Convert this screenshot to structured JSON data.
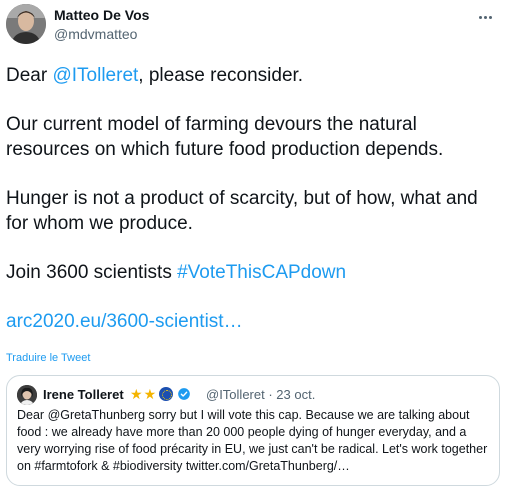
{
  "author": {
    "name": "Matteo De Vos",
    "handle": "@mdvmatteo"
  },
  "tweet": {
    "line1_prefix": "Dear ",
    "line1_mention": "@ITolleret",
    "line1_suffix": ", please reconsider.",
    "para2": "Our current model of farming devours the natural resources on which future food production depends.",
    "para3": "Hunger is not a product of scarcity, but of how, what and for whom we produce.",
    "para4_prefix": "Join 3600 scientists ",
    "para4_hashtag": "#VoteThisCAPdown",
    "link": "arc2020.eu/3600-scientist…"
  },
  "translate_label": "Traduire le Tweet",
  "quoted": {
    "name": "Irene Tolleret",
    "badges": [
      "star-icon",
      "star-icon",
      "eu-flag-icon",
      "verified-icon"
    ],
    "handle": "@ITolleret",
    "separator": " · ",
    "date": "23 oct.",
    "text": "Dear @GretaThunberg sorry but I will vote this cap. Because we are talking about food : we already have more than 20 000 people dying of hunger everyday, and a very worrying rise of food précarity in EU, we just can't be radical. Let's work together on #farmtofork & #biodiversity twitter.com/GretaThunberg/…"
  },
  "colors": {
    "link": "#1d9bf0",
    "text": "#0f1419",
    "secondary": "#536471",
    "border": "#cfd9de"
  }
}
